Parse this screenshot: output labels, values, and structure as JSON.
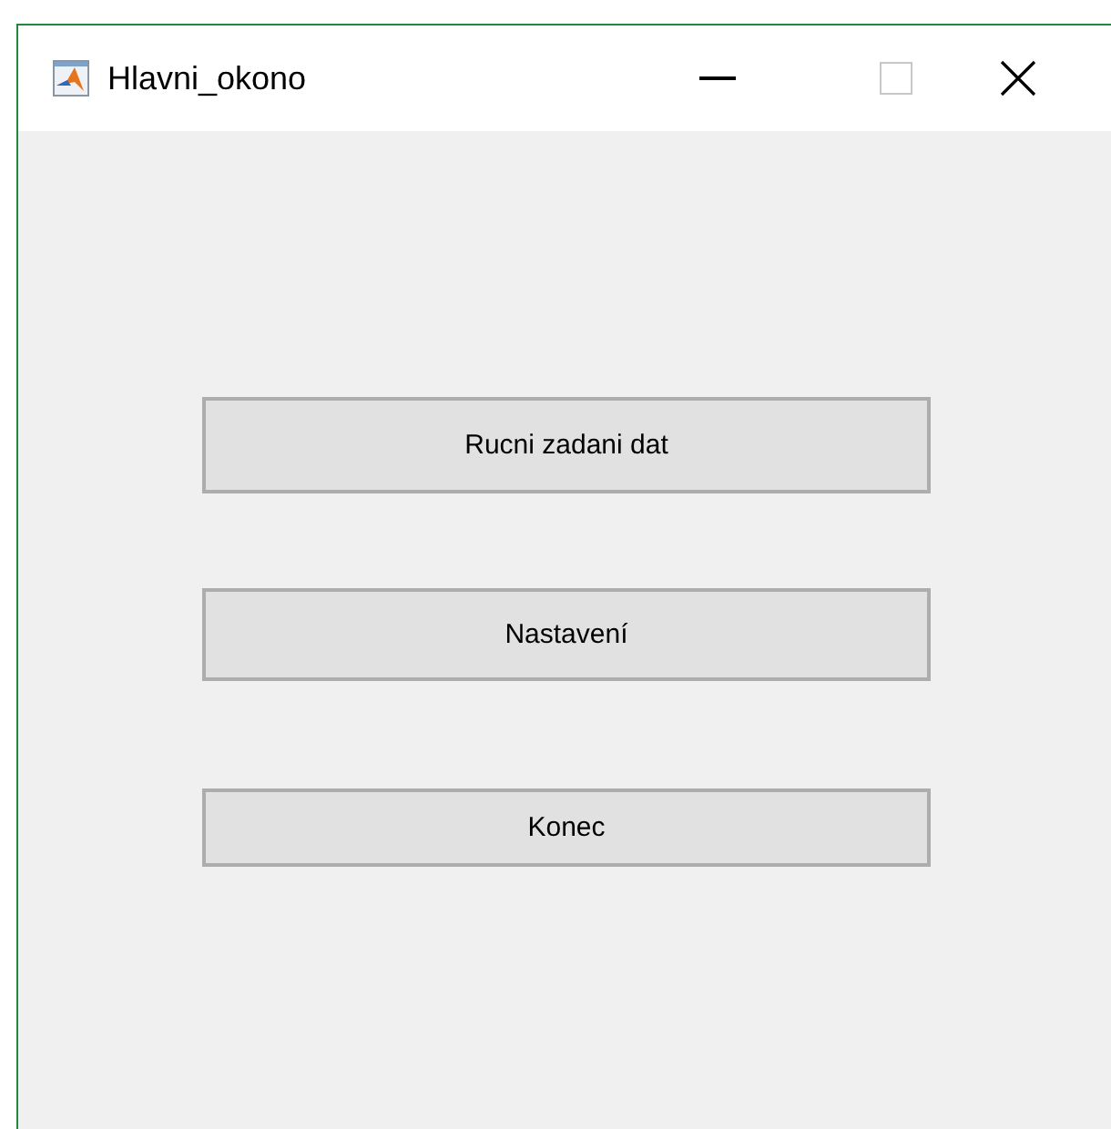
{
  "window": {
    "title": "Hlavni_okono"
  },
  "buttons": [
    {
      "label": "Rucni zadani dat"
    },
    {
      "label": "Nastavení"
    },
    {
      "label": "Konec"
    }
  ]
}
